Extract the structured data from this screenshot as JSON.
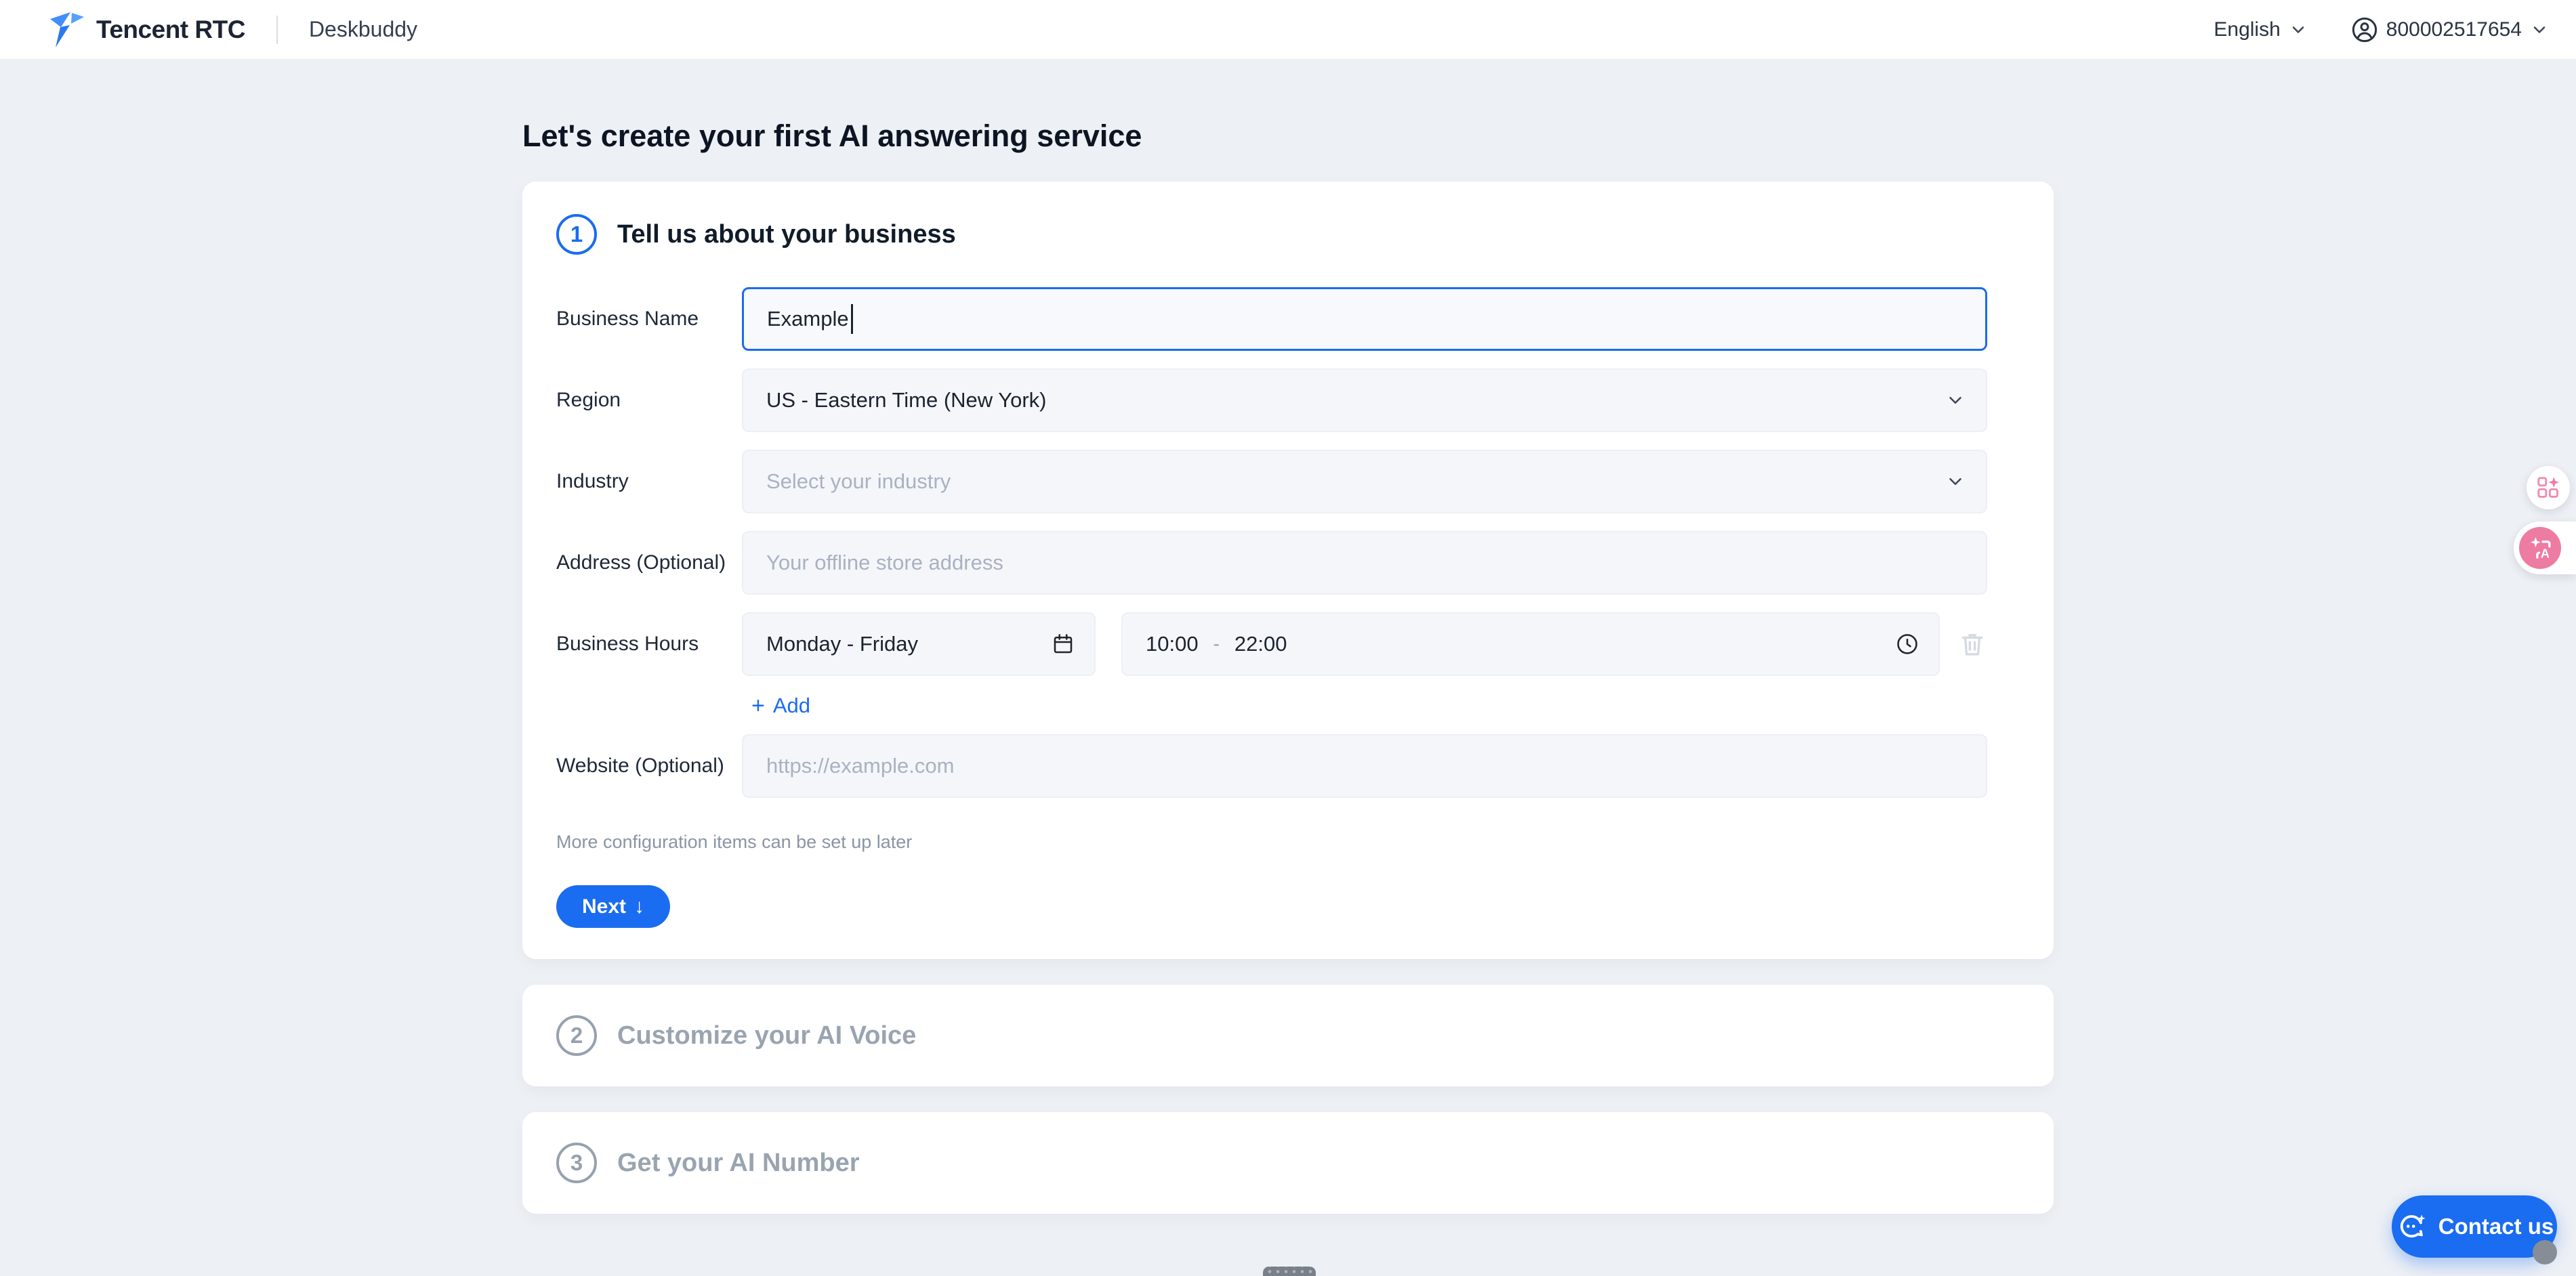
{
  "header": {
    "brand": "Tencent RTC",
    "product": "Deskbuddy",
    "language": "English",
    "account_id": "800002517654"
  },
  "page": {
    "title": "Let's create your first AI answering service"
  },
  "steps": [
    {
      "number": "1",
      "title": "Tell us about your business",
      "state": "active"
    },
    {
      "number": "2",
      "title": "Customize your AI Voice",
      "state": "disabled"
    },
    {
      "number": "3",
      "title": "Get your AI Number",
      "state": "disabled"
    }
  ],
  "form": {
    "business_name": {
      "label": "Business Name",
      "value": "Example"
    },
    "region": {
      "label": "Region",
      "value": "US - Eastern Time (New York)"
    },
    "industry": {
      "label": "Industry",
      "placeholder": "Select your industry"
    },
    "address": {
      "label": "Address (Optional)",
      "placeholder": "Your offline store address"
    },
    "business_hours": {
      "label": "Business Hours",
      "days_value": "Monday - Friday",
      "time_start": "10:00",
      "time_separator": "-",
      "time_end": "22:00",
      "add_plus": "+",
      "add_label": "Add"
    },
    "website": {
      "label": "Website (Optional)",
      "placeholder": "https://example.com"
    },
    "note": "More configuration items can be set up later",
    "next_label": "Next",
    "next_arrow": "↓"
  },
  "contact": {
    "label": "Contact us"
  },
  "icons": {
    "header": [
      "tencent-rtc-logo",
      "chevron-down-icon",
      "person-circle-icon"
    ],
    "form": [
      "calendar-icon",
      "clock-icon",
      "trash-icon",
      "chevron-down-icon"
    ],
    "floating": [
      "apps-sparkle-icon",
      "ai-translate-icon"
    ],
    "contact": [
      "chat-bot-icon"
    ]
  },
  "colors": {
    "accent_blue": "#1a6cf0",
    "page_background": "#edf0f5",
    "card_background": "#ffffff",
    "disabled_gray": "#97a1ae",
    "placeholder_gray": "#a9b2c1",
    "widget_pink": "#ee7ba1"
  }
}
